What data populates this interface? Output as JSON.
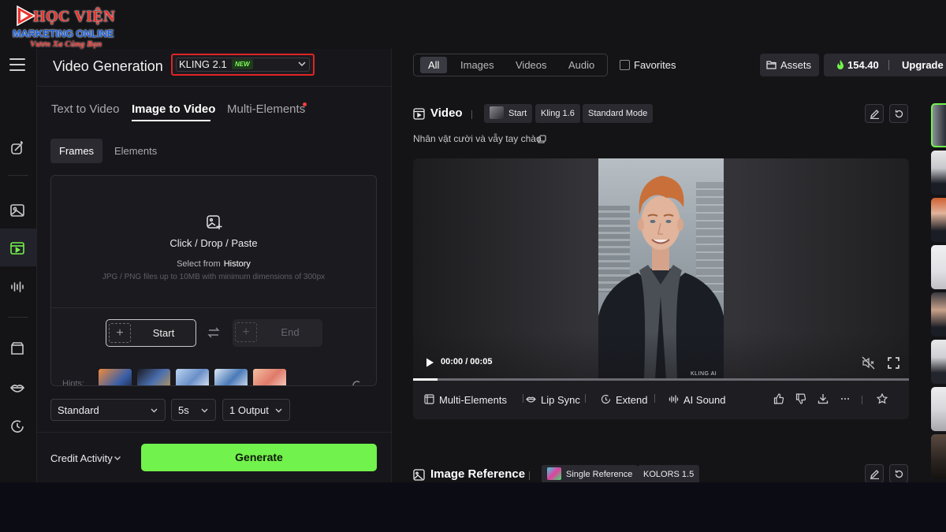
{
  "logo": {
    "line1": "HỌC VIỆN",
    "line2": "MARKETING ONLINE",
    "line3": "Vươn Xa Cùng Bạn"
  },
  "left_panel": {
    "title": "Video Generation",
    "model": {
      "name": "KLING 2.1",
      "badge": "NEW"
    },
    "tabs": [
      {
        "label": "Text to Video",
        "active": false
      },
      {
        "label": "Image to Video",
        "active": true
      },
      {
        "label": "Multi-Elements",
        "active": false
      }
    ],
    "subtabs": [
      {
        "label": "Frames",
        "active": true
      },
      {
        "label": "Elements",
        "active": false
      }
    ],
    "upload": {
      "main": "Click / Drop / Paste",
      "select_from": "Select from",
      "history_link": "History",
      "hint": "JPG / PNG files up to 10MB with minimum dimensions of 300px"
    },
    "frames": {
      "start": "Start",
      "end": "End"
    },
    "hints_label": "Hints:",
    "options": {
      "mode": "Standard",
      "duration": "5s",
      "outputs": "1 Output"
    },
    "credit_activity": "Credit Activity",
    "generate": "Generate"
  },
  "toolbar": {
    "filters": [
      {
        "label": "All",
        "active": true
      },
      {
        "label": "Images",
        "active": false
      },
      {
        "label": "Videos",
        "active": false
      },
      {
        "label": "Audio",
        "active": false
      }
    ],
    "favorites": "Favorites",
    "assets": "Assets",
    "credits": "154.40",
    "upgrade": "Upgrade P"
  },
  "video_card": {
    "title": "Video",
    "tags": [
      "Start",
      "Kling 1.6",
      "Standard Mode"
    ],
    "prompt": "Nhân vật cười và vẫy tay chào",
    "time": "00:00 / 00:05",
    "progress": 0.05,
    "watermark": "KLING AI",
    "actions": [
      "Multi-Elements",
      "Lip Sync",
      "Extend",
      "AI Sound"
    ]
  },
  "image_ref_card": {
    "title": "Image Reference",
    "tags": [
      "Single Reference",
      "KOLORS 1.5"
    ]
  },
  "colors": {
    "accent_green": "#72f24c",
    "highlight_red": "#e02424",
    "badge_green": "#7dff58"
  }
}
